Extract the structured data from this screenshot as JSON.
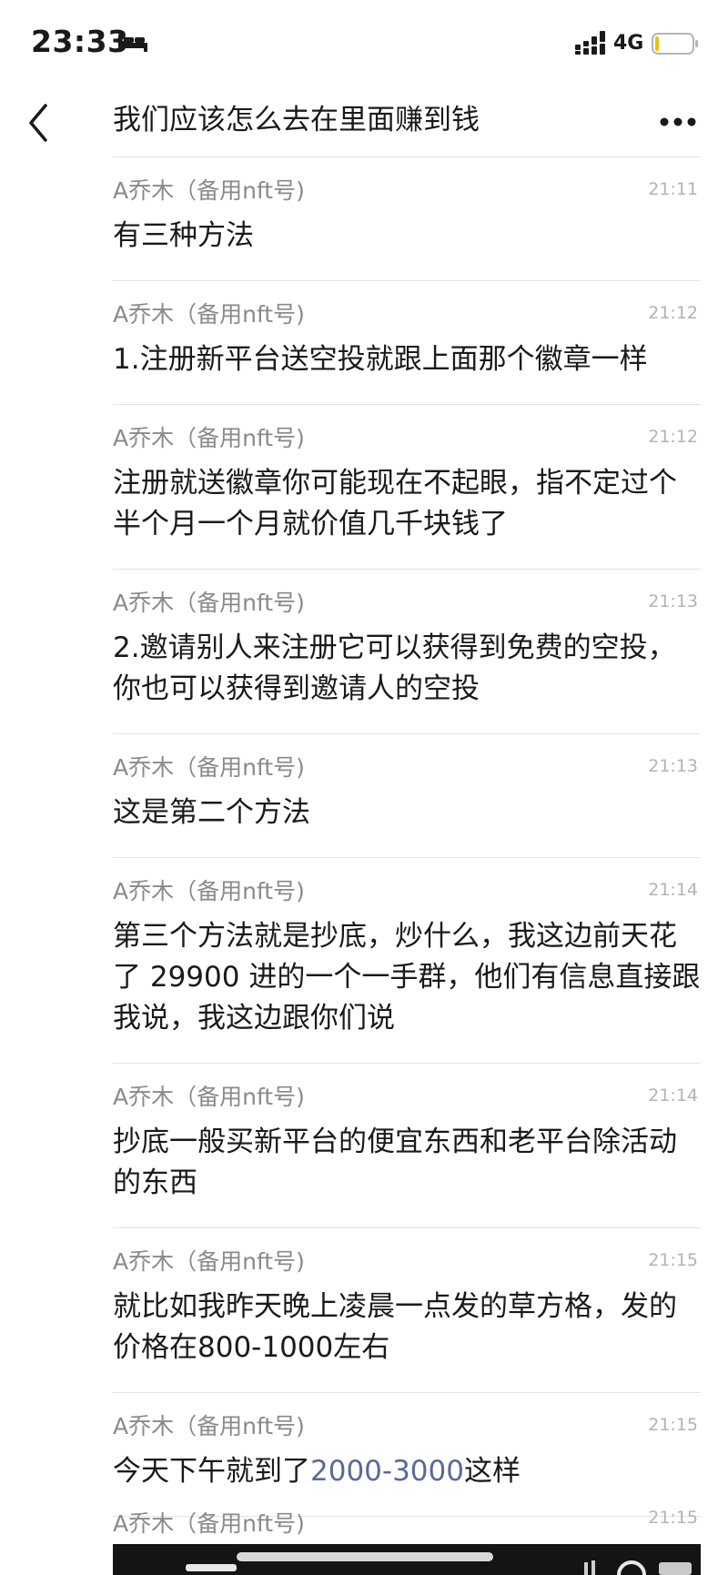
{
  "status_bar": {
    "time": "23:33",
    "network": "4G",
    "icons": [
      "bed-icon",
      "signal-bars-icon",
      "battery-icon"
    ]
  },
  "header": {
    "title": "我们应该怎么去在里面赚到钱",
    "back_icon": "chevron-left-icon",
    "more_icon": "more-dots-icon"
  },
  "messages": [
    {
      "sender": "A乔木（备用nft号)",
      "time": "21:11",
      "text": "有三种方法"
    },
    {
      "sender": "A乔木（备用nft号)",
      "time": "21:12",
      "text": "1.注册新平台送空投就跟上面那个徽章一样"
    },
    {
      "sender": "A乔木（备用nft号)",
      "time": "21:12",
      "text": "注册就送徽章你可能现在不起眼，指不定过个半个月一个月就价值几千块钱了"
    },
    {
      "sender": "A乔木（备用nft号)",
      "time": "21:13",
      "text": "2.邀请别人来注册它可以获得到免费的空投，你也可以获得到邀请人的空投"
    },
    {
      "sender": "A乔木（备用nft号)",
      "time": "21:13",
      "text": "这是第二个方法"
    },
    {
      "sender": "A乔木（备用nft号)",
      "time": "21:14",
      "text": "第三个方法就是抄底，炒什么，我这边前天花了 29900 进的一个一手群，他们有信息直接跟我说，我这边跟你们说"
    },
    {
      "sender": "A乔木（备用nft号)",
      "time": "21:14",
      "text": "抄底一般买新平台的便宜东西和老平台除活动的东西"
    },
    {
      "sender": "A乔木（备用nft号)",
      "time": "21:15",
      "text": "就比如我昨天晚上凌晨一点发的草方格，发的价格在800-1000左右"
    },
    {
      "sender": "A乔木（备用nft号)",
      "time": "21:15",
      "text_before": "今天下午就到了",
      "link": "2000-3000",
      "text_after": "这样"
    },
    {
      "sender": "A乔木（备用nft号)",
      "time": "21:15"
    }
  ],
  "colors": {
    "link": "#576b95",
    "sender": "#8a8a8a",
    "timestamp": "#b3b3b3",
    "divider": "#e2e2e2",
    "media_background": "#141414"
  }
}
